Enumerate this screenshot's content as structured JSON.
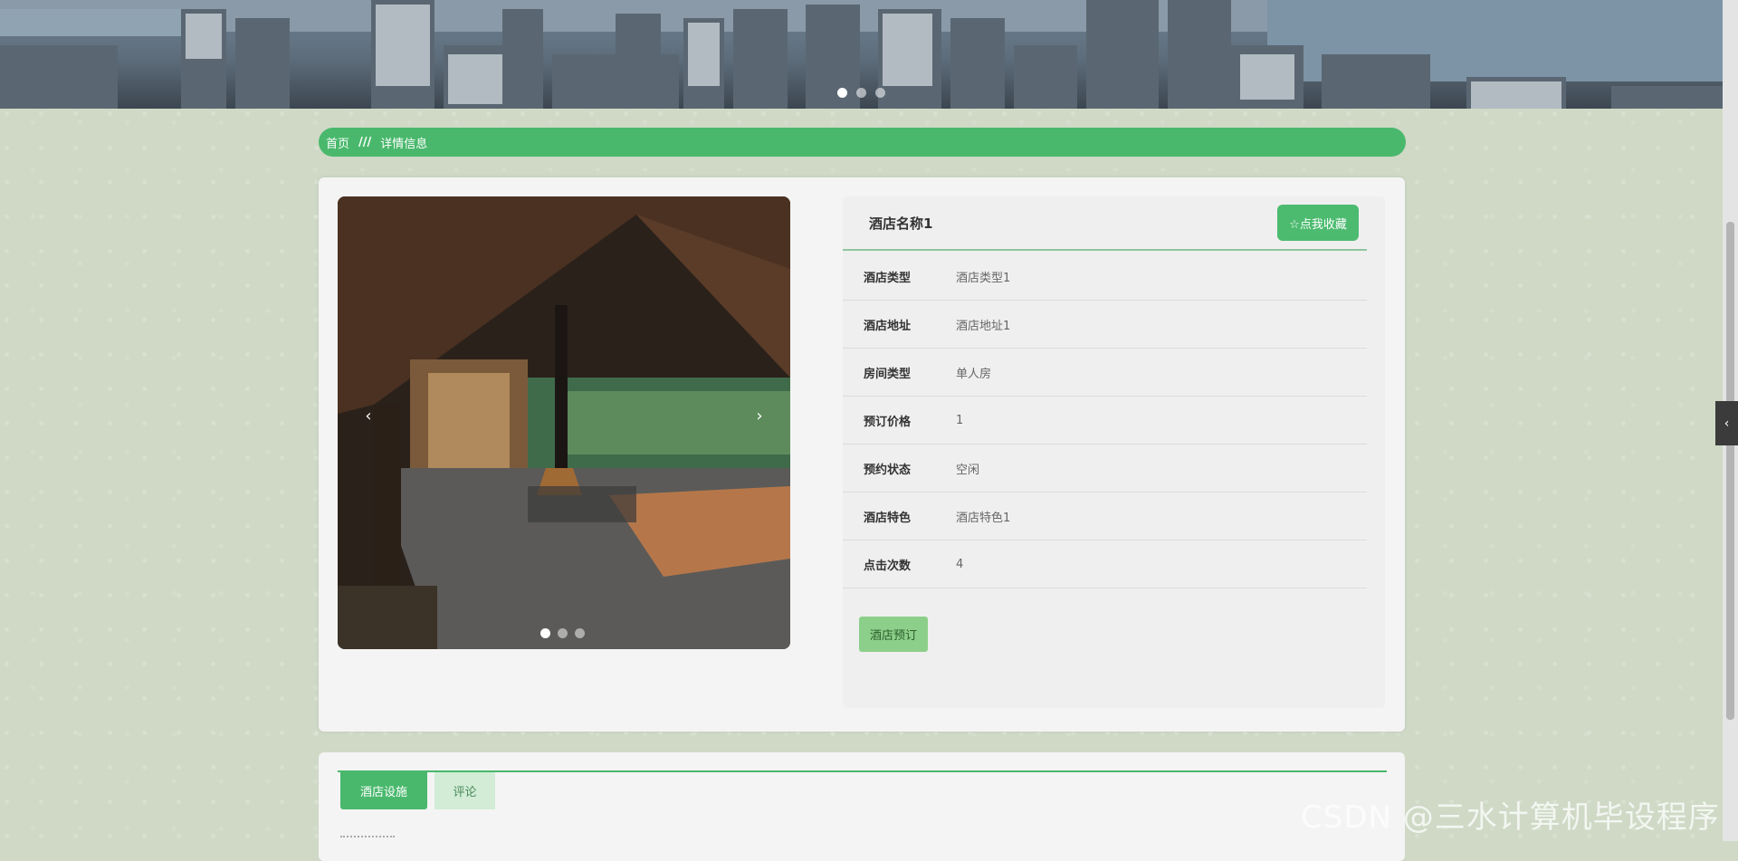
{
  "breadcrumb": {
    "home": "首页",
    "separator": "///",
    "current": "详情信息"
  },
  "hotel": {
    "name": "酒店名称1",
    "favorite_label": "☆点我收藏",
    "book_label": "酒店预订",
    "fields": [
      {
        "label": "酒店类型",
        "value": "酒店类型1"
      },
      {
        "label": "酒店地址",
        "value": "酒店地址1"
      },
      {
        "label": "房间类型",
        "value": "单人房"
      },
      {
        "label": "预订价格",
        "value": "1"
      },
      {
        "label": "预约状态",
        "value": "空闲"
      },
      {
        "label": "酒店特色",
        "value": "酒店特色1"
      },
      {
        "label": "点击次数",
        "value": "4"
      }
    ]
  },
  "carousel": {
    "prev_icon": "‹",
    "next_icon": "›"
  },
  "tabs": [
    {
      "label": "酒店设施",
      "active": true
    },
    {
      "label": "评论",
      "active": false
    }
  ],
  "side_tab": {
    "icon": "‹"
  },
  "watermark": "CSDN @三水计算机毕设程序",
  "colors": {
    "accent": "#49b86c",
    "book_button": "#8ccf8a",
    "tab_inactive": "#d2ecd6"
  }
}
